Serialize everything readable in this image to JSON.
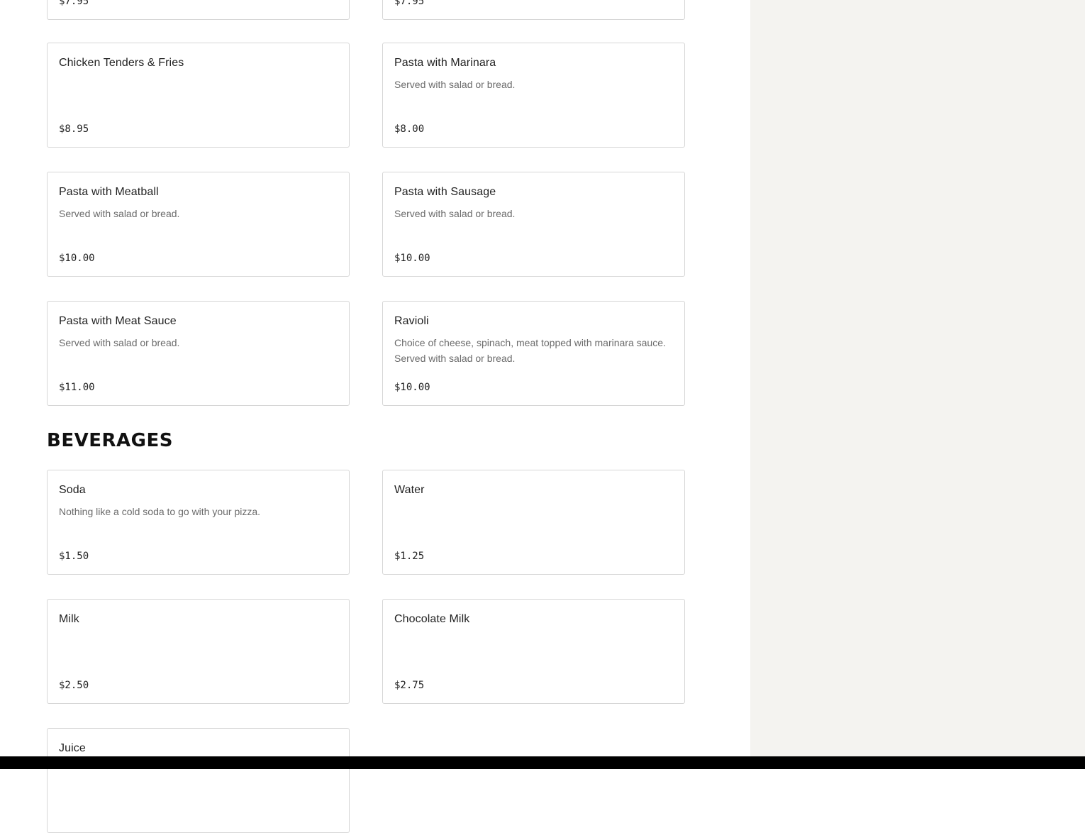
{
  "sections": {
    "beverages_title": "BEVERAGES"
  },
  "items": {
    "partial_left": {
      "price": "$7.95"
    },
    "partial_right": {
      "price": "$7.95"
    },
    "chicken_tenders": {
      "name": "Chicken Tenders & Fries",
      "price": "$8.95"
    },
    "pasta_marinara": {
      "name": "Pasta with Marinara",
      "desc": "Served with salad or bread.",
      "price": "$8.00"
    },
    "pasta_meatball": {
      "name": "Pasta with Meatball",
      "desc": "Served with salad or bread.",
      "price": "$10.00"
    },
    "pasta_sausage": {
      "name": "Pasta with Sausage",
      "desc": "Served with salad or bread.",
      "price": "$10.00"
    },
    "pasta_meat_sauce": {
      "name": "Pasta with Meat Sauce",
      "desc": "Served with salad or bread.",
      "price": "$11.00"
    },
    "ravioli": {
      "name": "Ravioli",
      "desc": "Choice of cheese, spinach, meat topped with marinara sauce. Served with salad or bread.",
      "price": "$10.00"
    },
    "soda": {
      "name": "Soda",
      "desc": "Nothing like a cold soda to go with your pizza.",
      "price": "$1.50"
    },
    "water": {
      "name": "Water",
      "price": "$1.25"
    },
    "milk": {
      "name": "Milk",
      "price": "$2.50"
    },
    "chocolate_milk": {
      "name": "Chocolate Milk",
      "price": "$2.75"
    },
    "juice": {
      "name": "Juice"
    }
  },
  "colors": {
    "sidebar_bg": "#f4f3f0",
    "card_border": "#d6d6d6",
    "description_text": "#6b6b6b",
    "bottom_bar": "#000000"
  }
}
